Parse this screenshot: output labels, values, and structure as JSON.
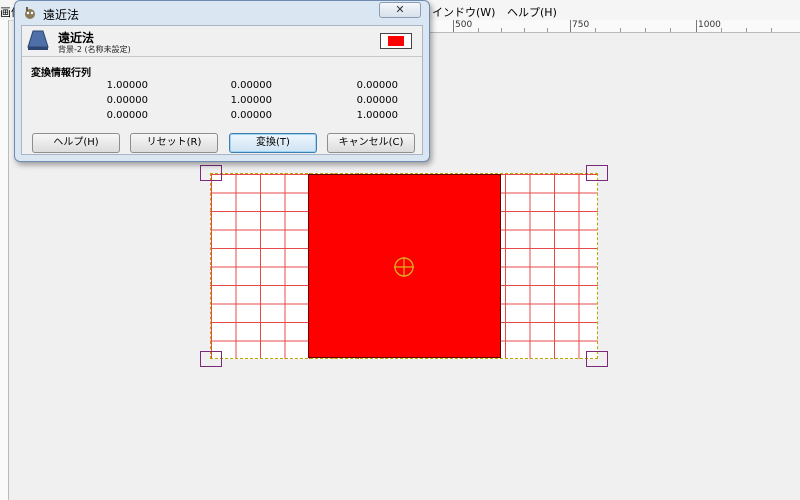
{
  "menubar": {
    "items": [
      {
        "label": "画像"
      },
      {
        "label": "インドウ(W)"
      },
      {
        "label": "ヘルプ(H)"
      }
    ]
  },
  "ruler": {
    "labels": [
      "500",
      "750",
      "1000"
    ]
  },
  "dialog": {
    "title": "遠近法",
    "close_label": "✕",
    "tool_title": "遠近法",
    "tool_subtitle": "背景-2 (名称未設定)",
    "preview_color": "#ff0000",
    "matrix_label": "変換情報行列",
    "matrix": [
      [
        "1.00000",
        "0.00000",
        "0.00000"
      ],
      [
        "0.00000",
        "1.00000",
        "0.00000"
      ],
      [
        "0.00000",
        "0.00000",
        "1.00000"
      ]
    ],
    "buttons": {
      "help": "ヘルプ(H)",
      "reset": "リセット(R)",
      "transform": "変換(T)",
      "cancel": "キャンセル(C)"
    }
  },
  "canvas": {
    "rect_color": "#ff0000",
    "grid_color": "#e84a4a",
    "handle_color": "#7b2a7b"
  }
}
